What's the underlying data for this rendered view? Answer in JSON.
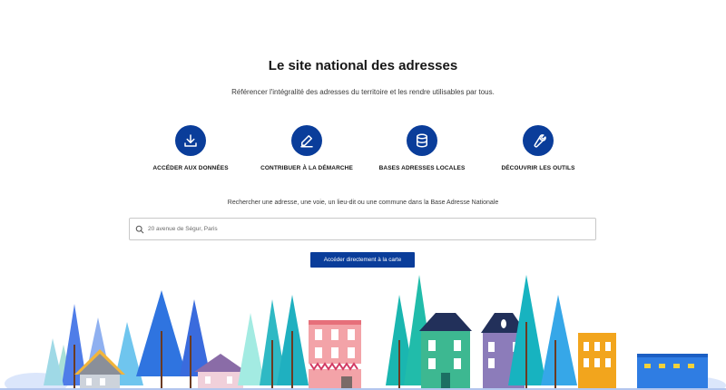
{
  "header": {
    "title": "Le site national des adresses",
    "subtitle": "Référencer l'intégralité des adresses du territoire et les rendre utilisables par tous."
  },
  "features": [
    {
      "label": "ACCÉDER AUX DONNÉES",
      "icon": "download-icon"
    },
    {
      "label": "CONTRIBUER À LA DÉMARCHE",
      "icon": "pencil-icon"
    },
    {
      "label": "BASES ADRESSES LOCALES",
      "icon": "database-icon"
    },
    {
      "label": "DÉCOUVRIR LES OUTILS",
      "icon": "wrench-icon"
    }
  ],
  "search": {
    "caption": "Rechercher une adresse, une voie, un lieu-dit ou une commune dans la Base Adresse Nationale",
    "placeholder": "20 avenue de Ségur, Paris",
    "value": ""
  },
  "map_button": {
    "label": "Accéder directement à la carte"
  },
  "colors": {
    "brand": "#0a3d9a",
    "text": "#161616",
    "border": "#c8c8c8"
  }
}
